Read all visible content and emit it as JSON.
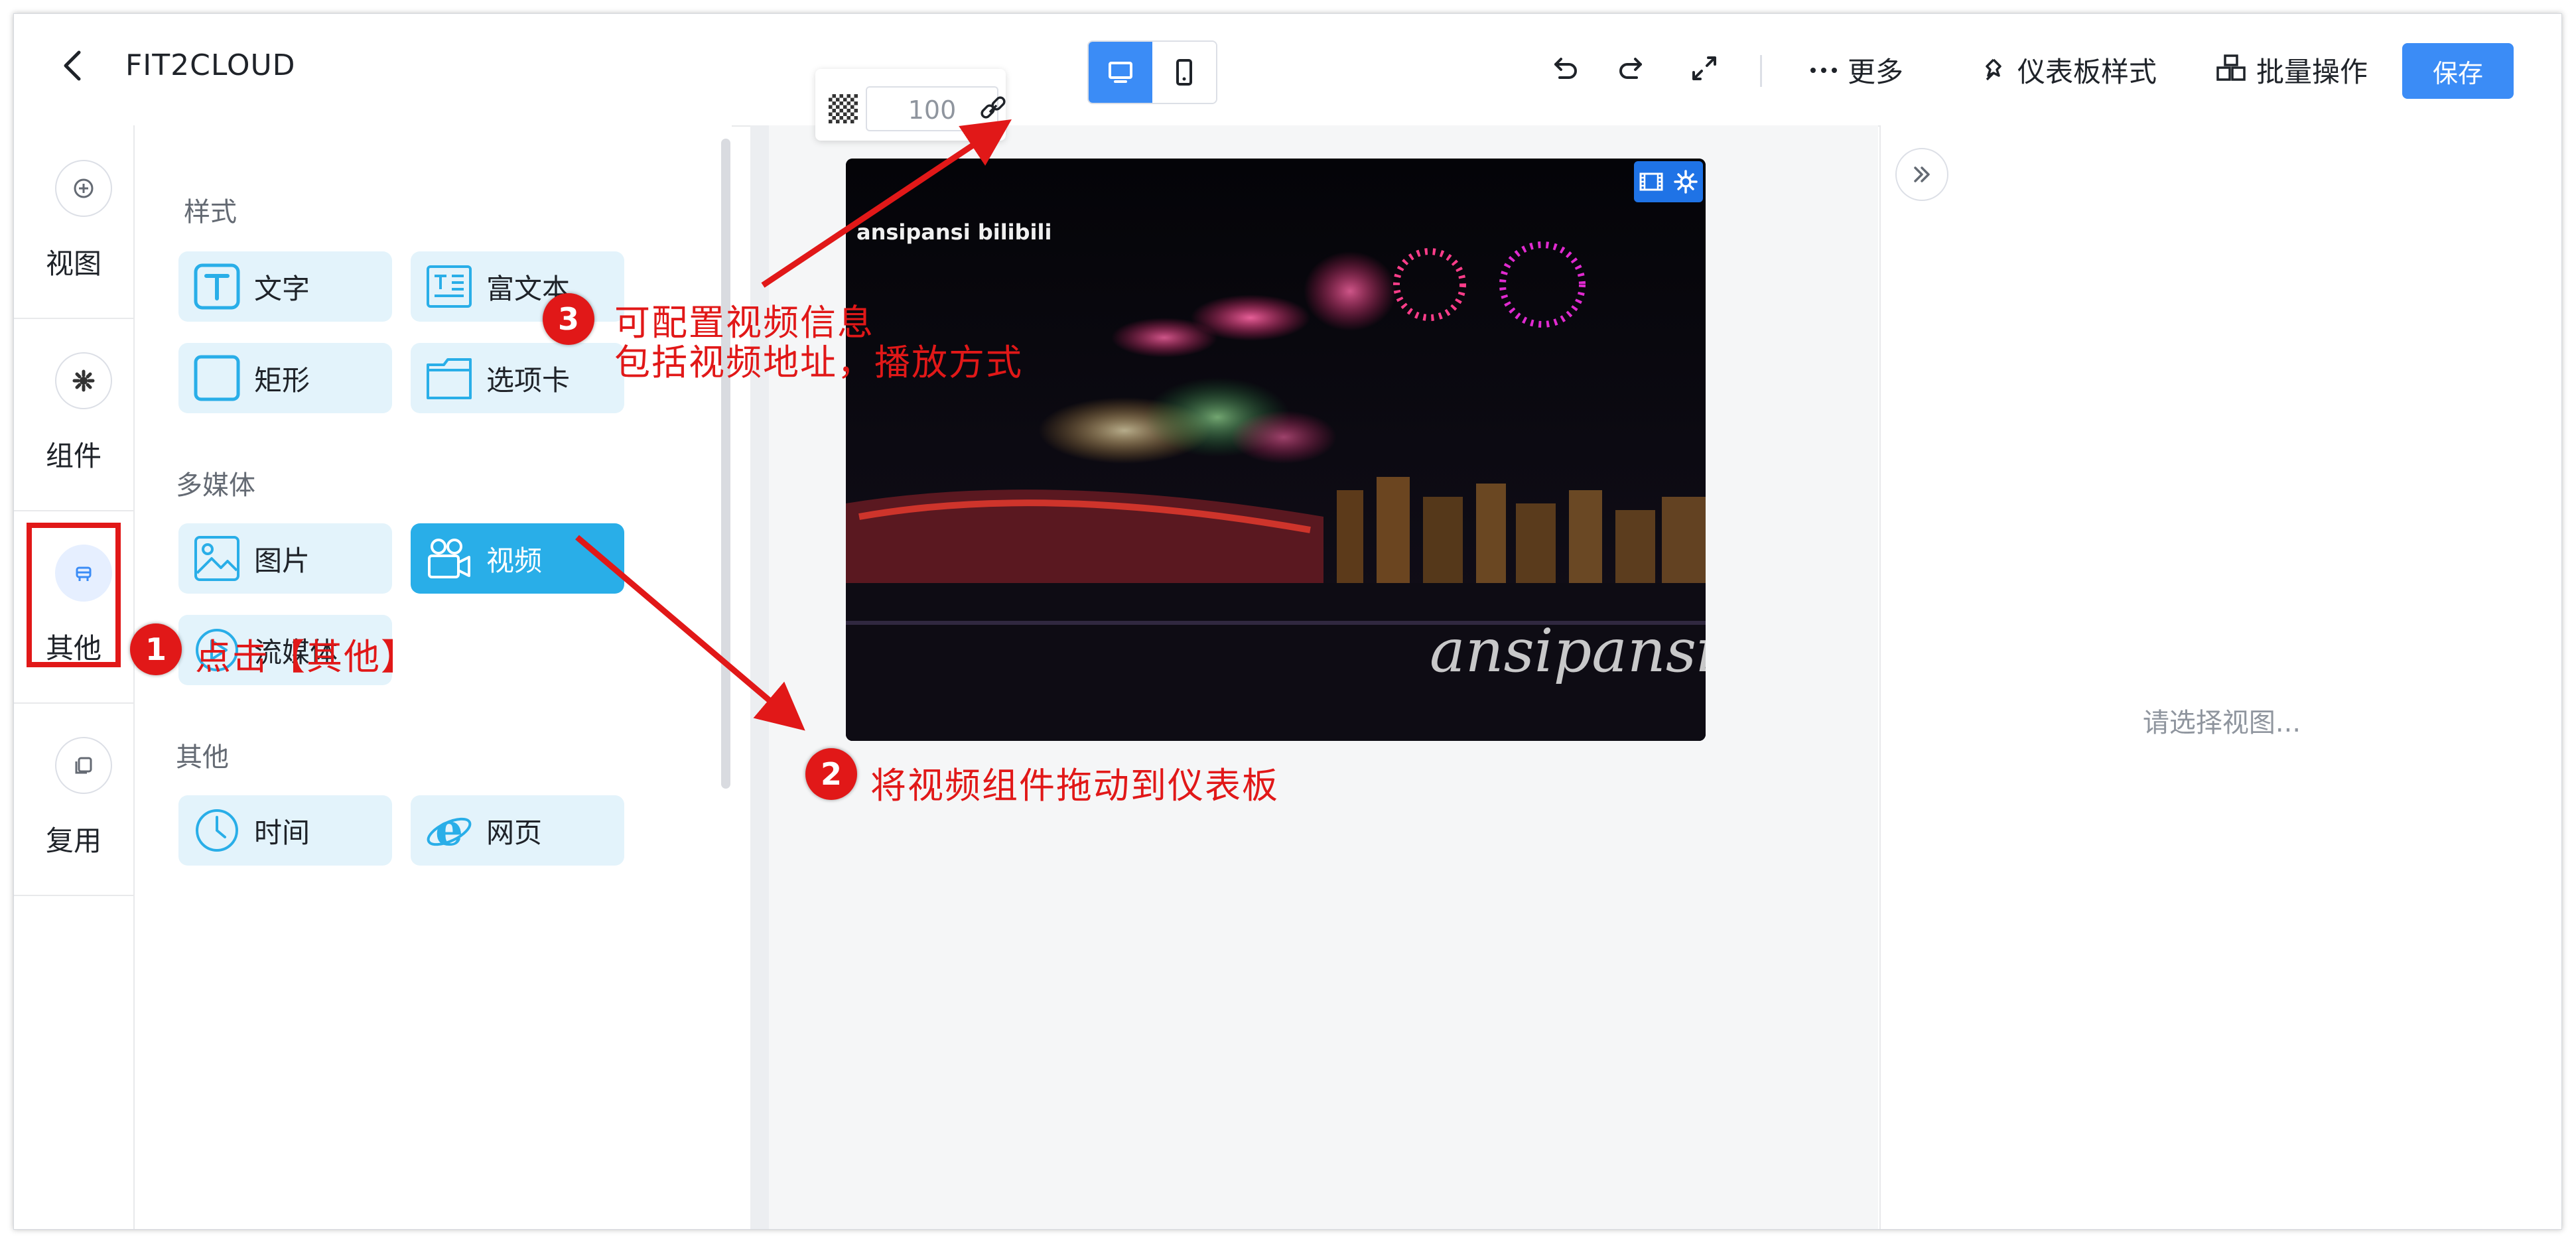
{
  "header": {
    "title": "FIT2CLOUD",
    "more_label": "更多",
    "style_label": "仪表板样式",
    "batch_label": "批量操作",
    "save_label": "保存"
  },
  "opacity": {
    "value": "100"
  },
  "side_nav": {
    "items": [
      {
        "label": "视图",
        "icon": "plus-circle-icon"
      },
      {
        "label": "组件",
        "icon": "gear-icon"
      },
      {
        "label": "其他",
        "icon": "other-icon",
        "active": true
      },
      {
        "label": "复用",
        "icon": "copy-icon"
      }
    ]
  },
  "component_panel": {
    "sections": [
      {
        "title": "样式",
        "tiles": [
          {
            "label": "文字",
            "icon": "text-icon"
          },
          {
            "label": "富文本",
            "icon": "rich-text-icon"
          },
          {
            "label": "矩形",
            "icon": "rectangle-icon"
          },
          {
            "label": "选项卡",
            "icon": "tabs-icon"
          }
        ]
      },
      {
        "title": "多媒体",
        "tiles": [
          {
            "label": "图片",
            "icon": "image-icon"
          },
          {
            "label": "视频",
            "icon": "video-icon",
            "active": true
          },
          {
            "label": "流媒体",
            "icon": "stream-icon"
          }
        ]
      },
      {
        "title": "其他",
        "tiles": [
          {
            "label": "时间",
            "icon": "clock-icon"
          },
          {
            "label": "网页",
            "icon": "web-icon"
          }
        ]
      }
    ]
  },
  "canvas": {
    "video": {
      "watermark": "ansipansi",
      "logo": "ansipansi bilibili"
    }
  },
  "right_panel": {
    "placeholder": "请选择视图..."
  },
  "annotations": {
    "step1_num": "1",
    "step1_text": "点击【其他】",
    "step2_num": "2",
    "step2_text": "将视频组件拖动到仪表板",
    "step3_num": "3",
    "step3_line1": "可配置视频信息",
    "step3_line2": "包括视频地址，播放方式"
  },
  "colors": {
    "primary": "#3b8cf6",
    "tile_bg": "#e3f3fb",
    "tile_active": "#29aee8",
    "annotation": "#e11818"
  }
}
